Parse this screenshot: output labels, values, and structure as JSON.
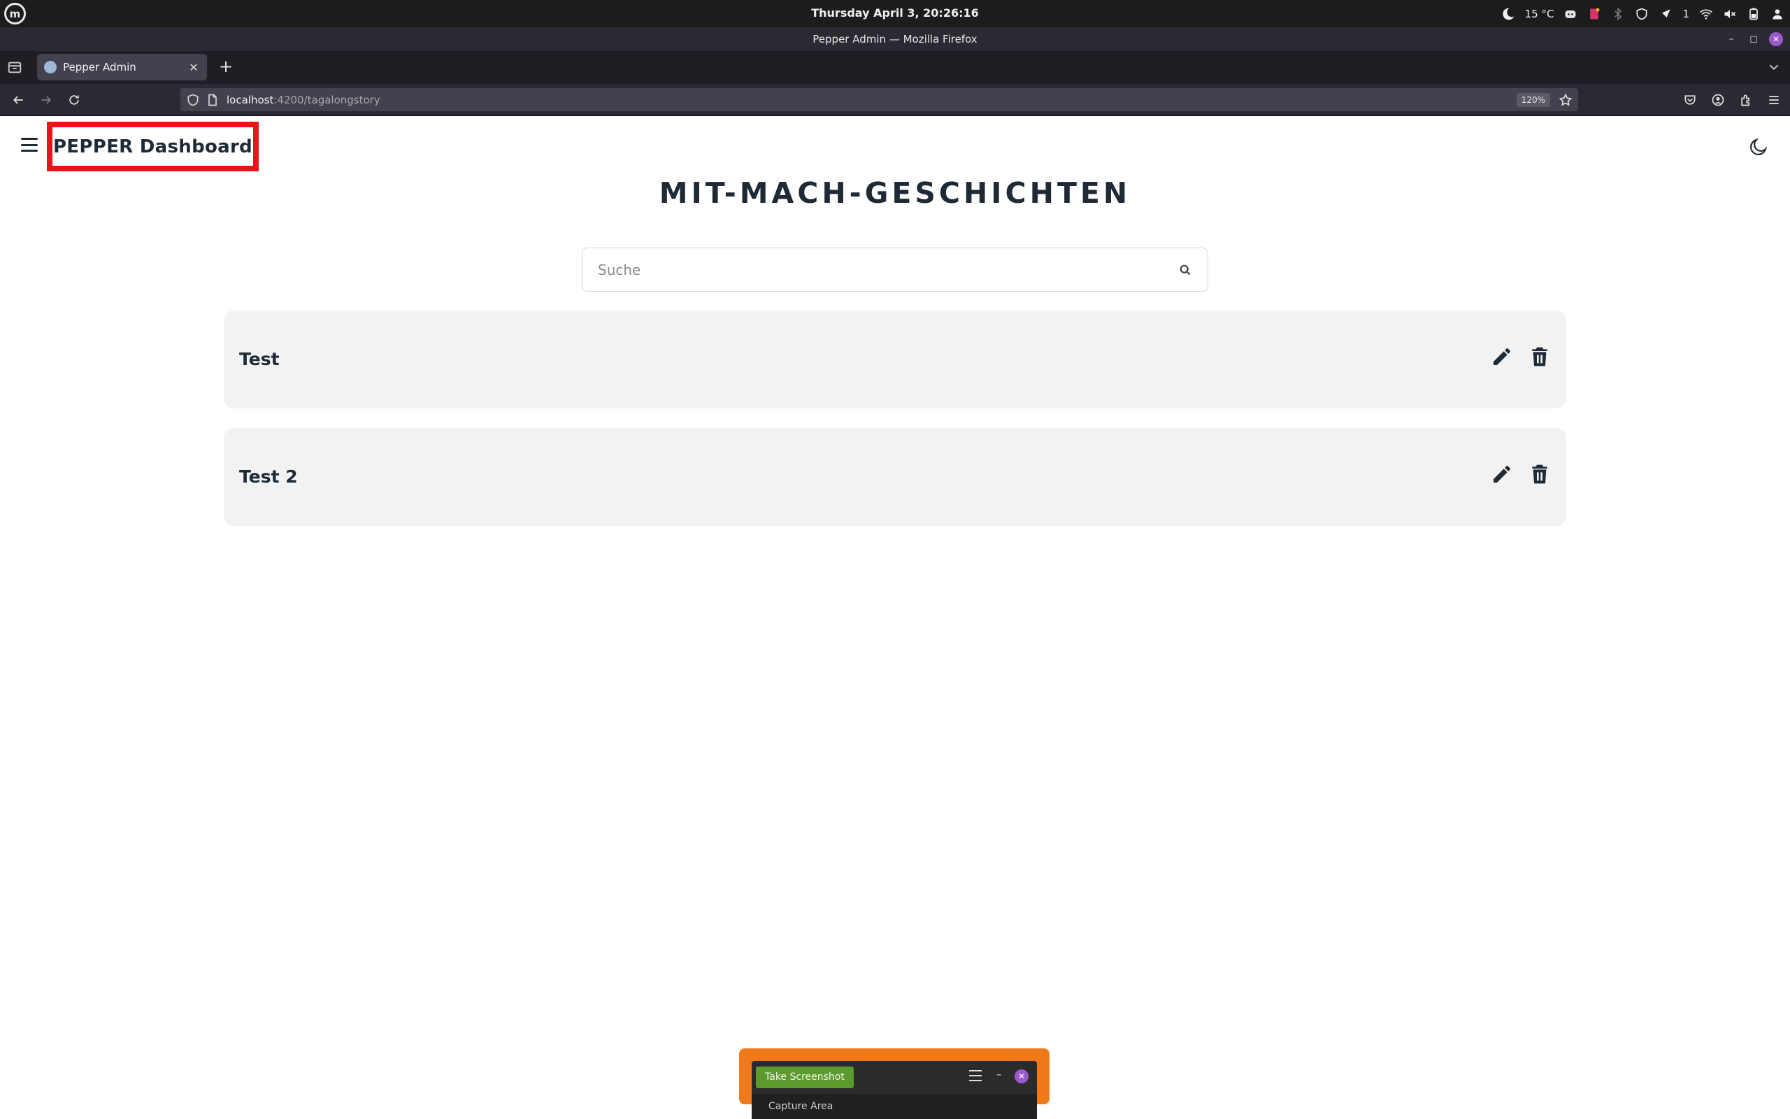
{
  "os_panel": {
    "clock": "Thursday April 3, 20:26:16",
    "weather": "15 °C",
    "notification_count": "1"
  },
  "window": {
    "title": "Pepper Admin — Mozilla Firefox"
  },
  "browser": {
    "tab_title": "Pepper Admin",
    "url_host": "localhost",
    "url_rest": ":4200/tagalongstory",
    "zoom": "120%"
  },
  "app": {
    "brand": "PEPPER Dashboard",
    "page_title": "MIT-MACH-GESCHICHTEN",
    "search": {
      "placeholder": "Suche",
      "value": ""
    },
    "stories": [
      {
        "title": "Test"
      },
      {
        "title": "Test 2"
      }
    ],
    "accent_highlight": "#e8141a"
  },
  "screenshot_tool": {
    "take_label": "Take Screenshot",
    "mode_label": "Capture Area"
  }
}
